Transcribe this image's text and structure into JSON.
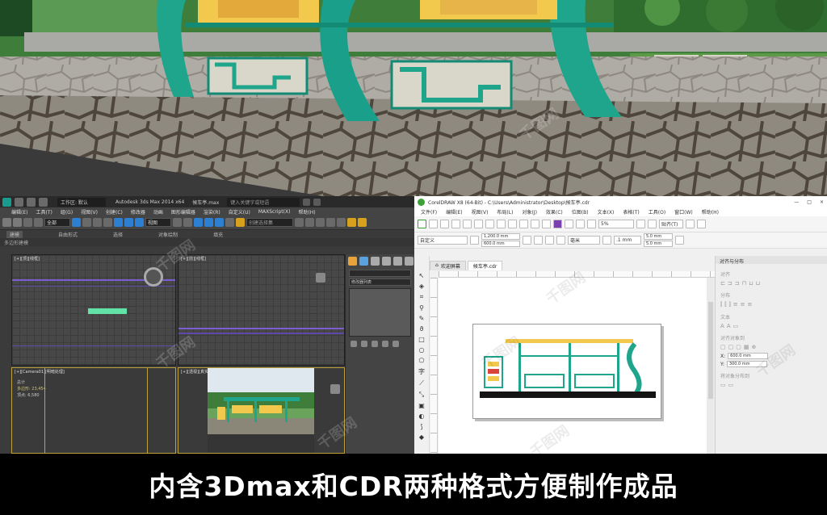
{
  "caption": "内含3Dmax和CDR两种格式方便制作成品",
  "watermark": "千图网",
  "max": {
    "title_app_icon": "3ds-max-icon",
    "title_workspace": "工作区: 默认",
    "title_app": "Autodesk 3ds Max 2014 x64",
    "title_file": "候车亭.max",
    "title_search": "键入关键字或短语",
    "menu": [
      "编辑(E)",
      "工具(T)",
      "组(G)",
      "视图(V)",
      "创建(C)",
      "修改器",
      "动画",
      "图形编辑器",
      "渲染(R)",
      "自定义(U)",
      "MAXScript(X)",
      "帮助(H)"
    ],
    "toolbar_select": "全部",
    "toolbar_view": "视图",
    "toolbar_selection_set": "创建选择集",
    "ribbon": [
      "建模",
      "自由形式",
      "选择",
      "对象绘制",
      "填充"
    ],
    "sub_label": "多边形建模",
    "viewports": [
      {
        "label": "[+][顶][线框]"
      },
      {
        "label": "[+][前][线框]"
      },
      {
        "label": "[+][Camera01][明暗处理]"
      },
      {
        "label": "[+][透视][真实]"
      }
    ],
    "stats": {
      "line1": "总计",
      "line2": "多边形: 23,454",
      "line3": "顶点: 6,580"
    },
    "panel": {
      "modifier_list": "修改器列表"
    }
  },
  "cdr": {
    "title": "CorelDRAW X8 (64-Bit) - C:\\Users\\Administrator\\Desktop\\候车亭.cdr",
    "window_controls": [
      "—",
      "□",
      "×"
    ],
    "menu": [
      "文件(F)",
      "编辑(E)",
      "视图(V)",
      "布局(L)",
      "对象(J)",
      "效果(C)",
      "位图(B)",
      "文本(X)",
      "表格(T)",
      "工具(O)",
      "窗口(W)",
      "帮助(H)"
    ],
    "zoom": "5%",
    "snap": "贴齐(T)",
    "paper": "自定义",
    "width": "1,200.0 mm",
    "height": "600.0 mm",
    "units": "毫米",
    "nudge": ".1 mm",
    "dup_x": "5.0 mm",
    "dup_y": "5.0 mm",
    "tabs": [
      "欢迎屏幕",
      "候车亭.cdr"
    ],
    "dock": {
      "title": "对齐与分布",
      "align": "对齐",
      "distribute": "分布",
      "text": "文本",
      "align_objects": "对齐对象到",
      "dist_to": "将对象分布到",
      "x": "600.0 mm",
      "y": "300.0 mm"
    }
  },
  "colors": {
    "teal": "#1fa58c",
    "board_yellow": "#f2c94c",
    "max_bg": "#3b3b3b",
    "cdr_bg": "#f0f0f0"
  }
}
